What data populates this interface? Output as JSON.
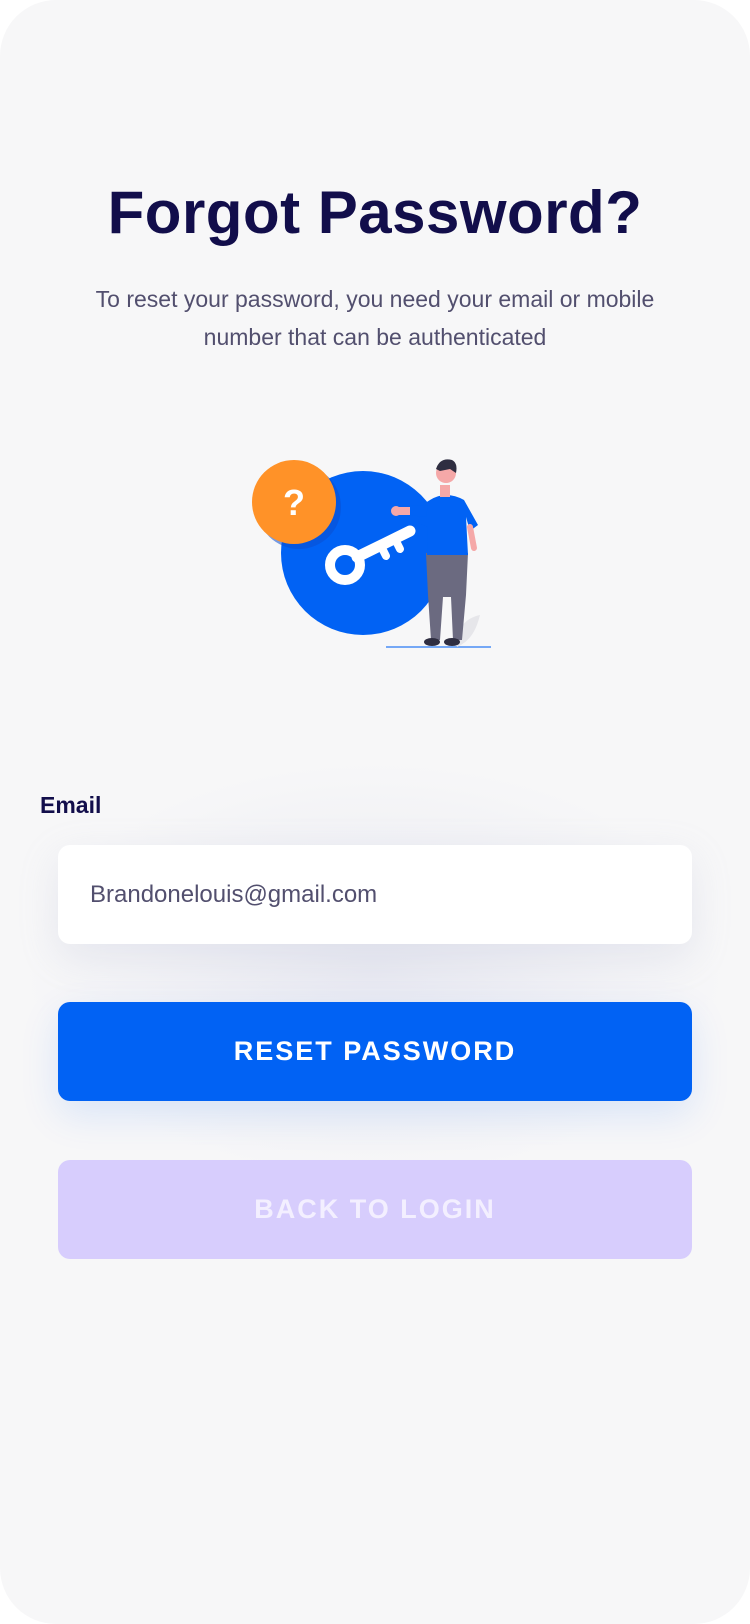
{
  "page": {
    "title": "Forgot Password?",
    "subtitle": "To reset your password, you need your email or mobile number that can be authenticated"
  },
  "illustration": {
    "icon": "forgot-password-key-illustration",
    "badge_text": "?",
    "colors": {
      "blue": "#0162f4",
      "orange": "#ff9228",
      "pants": "#6b6a80",
      "skin": "#f5a8a8",
      "hair": "#2f2e41"
    }
  },
  "form": {
    "email_label": "Email",
    "email_value": "Brandonelouis@gmail.com",
    "email_placeholder": "Email"
  },
  "actions": {
    "reset_label": "RESET PASSWORD",
    "back_label": "BACK TO LOGIN"
  },
  "theme": {
    "background": "#f7f7f8",
    "heading": "#120e4b",
    "body_text": "#524f6e",
    "primary": "#0162f4",
    "secondary": "#d7cdfd"
  }
}
